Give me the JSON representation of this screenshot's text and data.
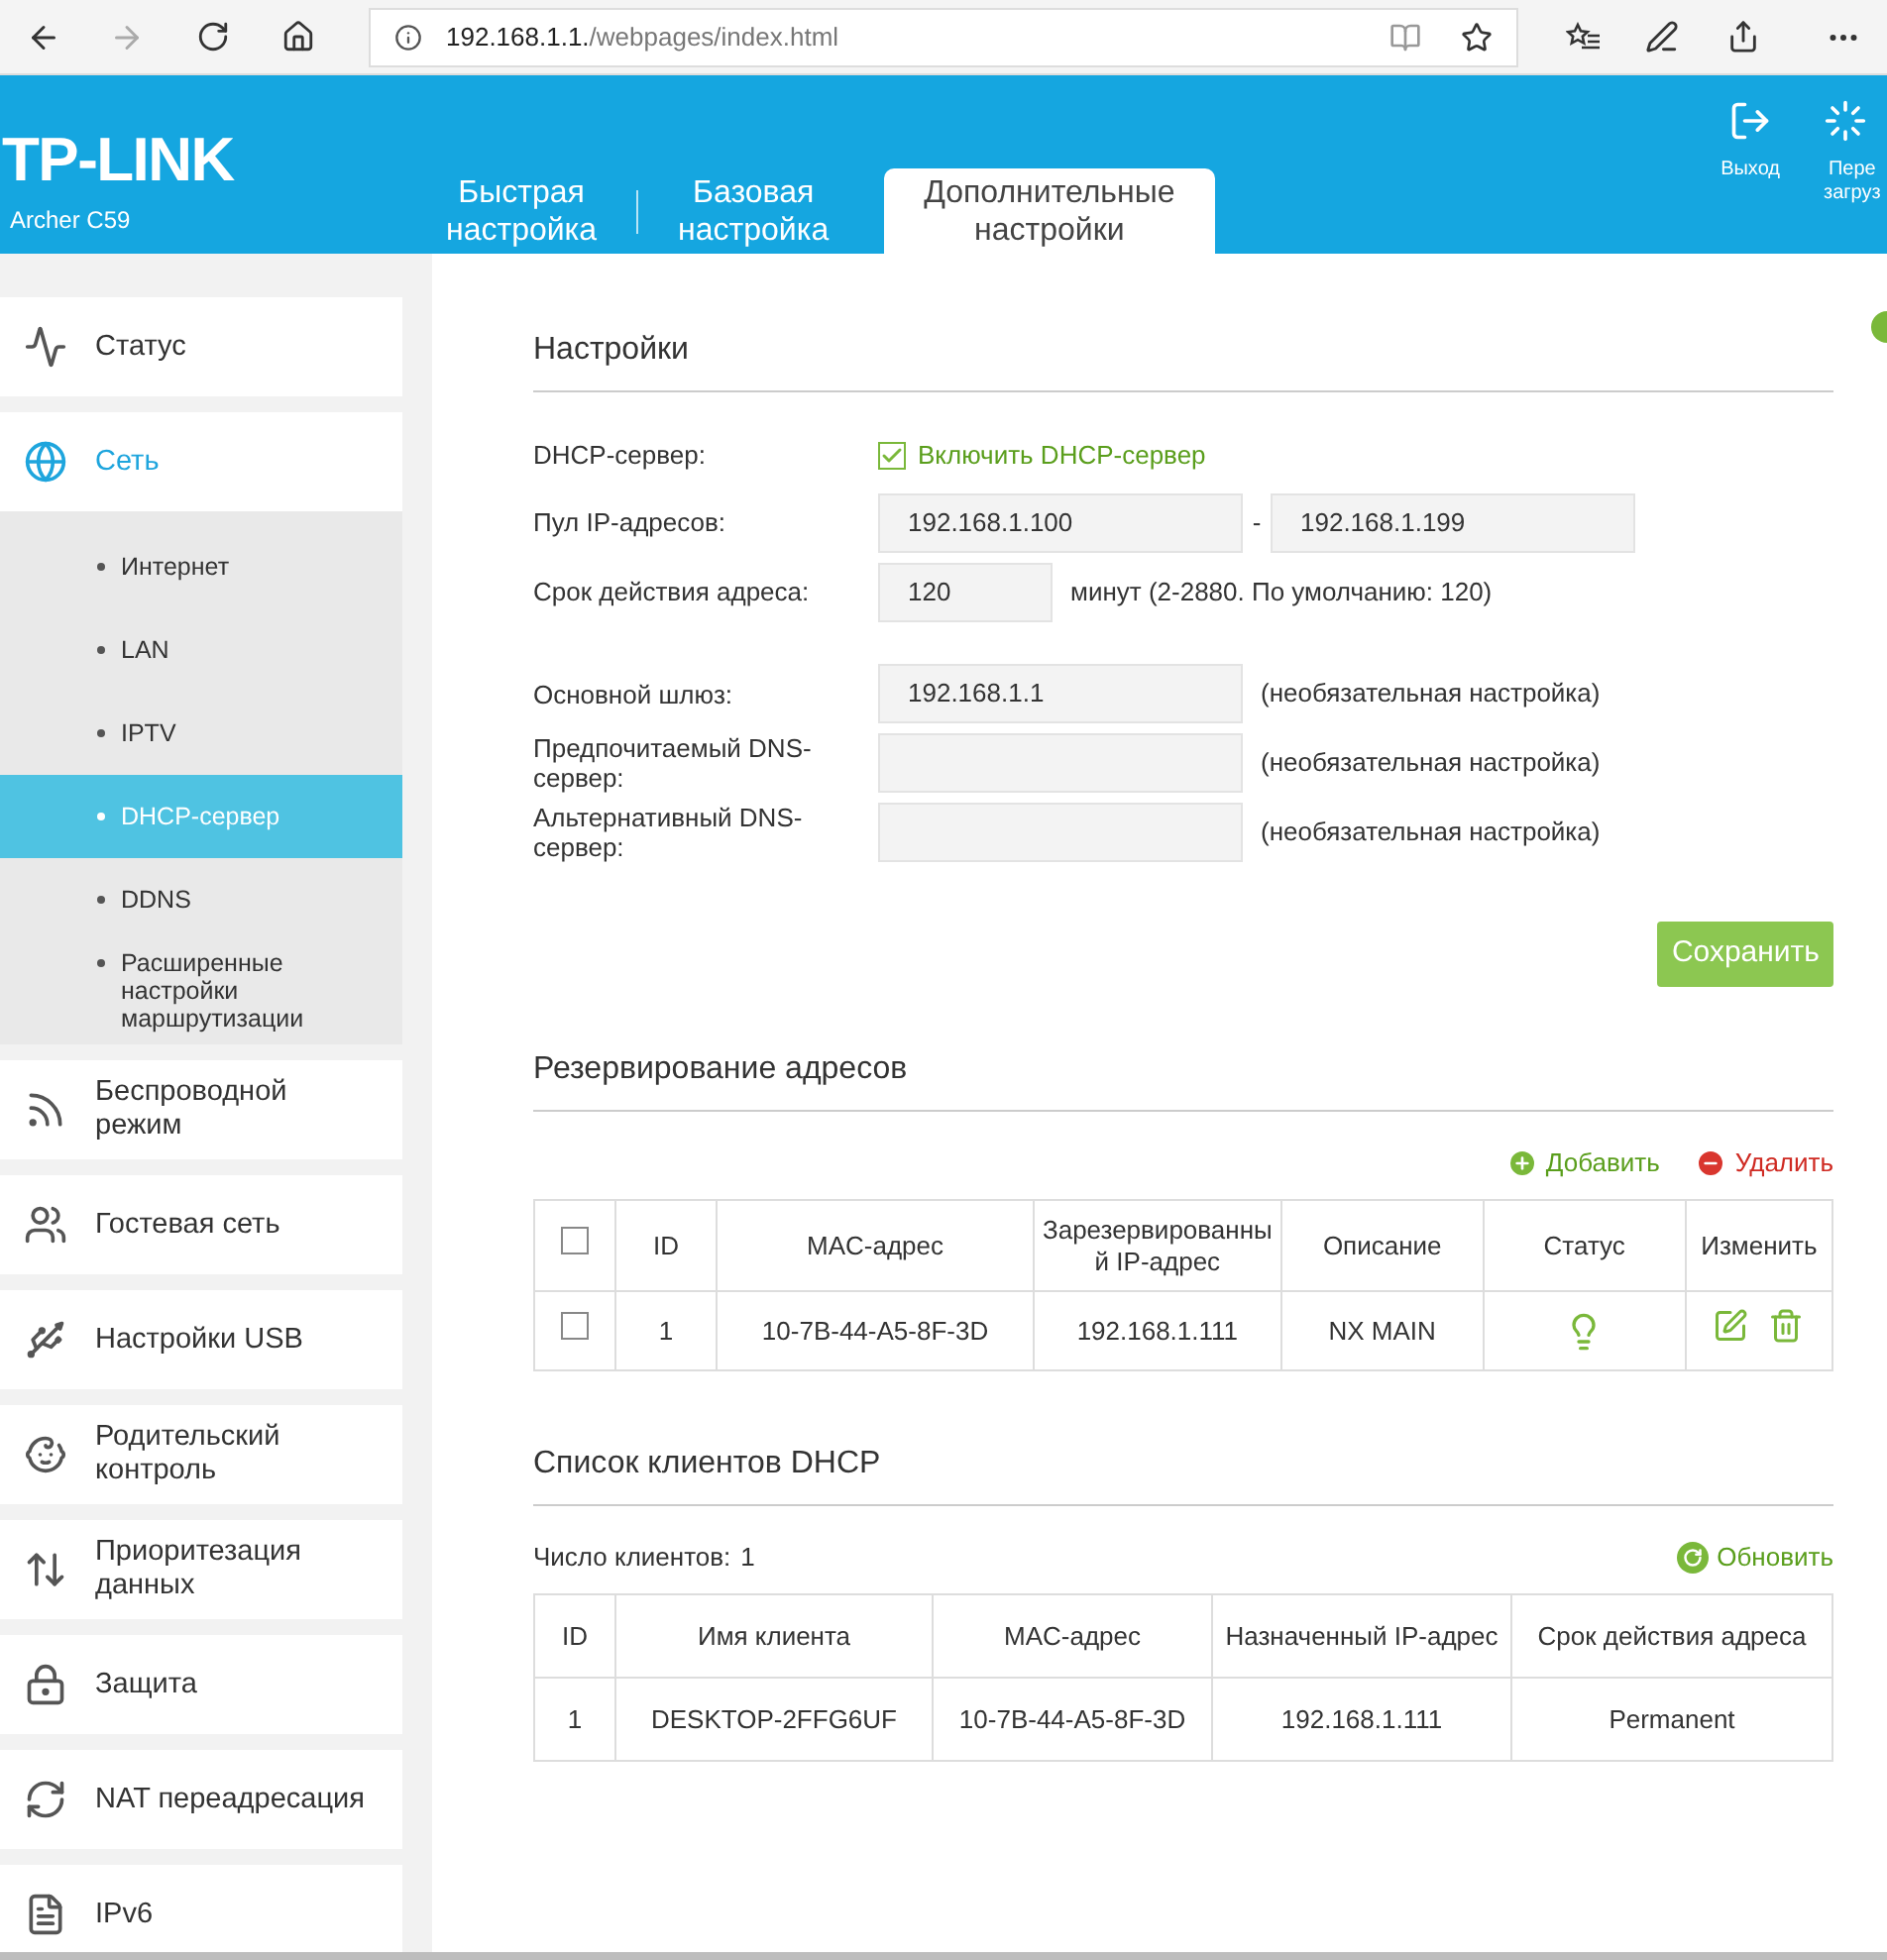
{
  "browser": {
    "url_host": "192.168.1.1.",
    "url_path": "/webpages/index.html",
    "forward_disabled": true
  },
  "header": {
    "logo": "TP-LINK",
    "model": "Archer C59",
    "tabs": [
      {
        "label": "Быстрая\nнастройка",
        "selected": false
      },
      {
        "label": "Базовая\nнастройка",
        "selected": false
      },
      {
        "label": "Дополнительные\nнастройки",
        "selected": true
      }
    ],
    "actions": [
      {
        "label": "Выход"
      },
      {
        "label": "Пере\nзагруз"
      }
    ]
  },
  "sidebar": {
    "items": [
      {
        "label": "Статус",
        "selected": false
      },
      {
        "label": "Сеть",
        "selected": true,
        "expanded": true,
        "children": [
          {
            "label": "Интернет",
            "selected": false
          },
          {
            "label": "LAN",
            "selected": false
          },
          {
            "label": "IPTV",
            "selected": false
          },
          {
            "label": "DHCP-сервер",
            "selected": true
          },
          {
            "label": "DDNS",
            "selected": false
          },
          {
            "label": "Расширенные\nнастройки\nмаршрутизации",
            "selected": false
          }
        ]
      },
      {
        "label": "Беспроводной\nрежим",
        "selected": false
      },
      {
        "label": "Гостевая сеть",
        "selected": false
      },
      {
        "label": "Настройки USB",
        "selected": false
      },
      {
        "label": "Родительский\nконтроль",
        "selected": false
      },
      {
        "label": "Приоритезация\nданных",
        "selected": false
      },
      {
        "label": "Защита",
        "selected": false
      },
      {
        "label": "NAT переадресация",
        "selected": false
      },
      {
        "label": "IPv6",
        "selected": false
      }
    ]
  },
  "settings": {
    "title": "Настройки",
    "dhcp": {
      "label": "DHCP-сервер:",
      "option": "Включить DHCP-сервер",
      "checked": true
    },
    "pool": {
      "label": "Пул IP-адресов:",
      "start": "192.168.1.100",
      "separator": "-",
      "end": "192.168.1.199"
    },
    "lease": {
      "label": "Срок действия адреса:",
      "value": "120",
      "hint": "минут (2-2880. По умолчанию: 120)"
    },
    "fields": [
      {
        "label": "Основной шлюз:",
        "value": "192.168.1.1",
        "hint": "(необязательная настройка)"
      },
      {
        "label": "Предпочитаемый DNS-\nсервер:",
        "hint": "(необязательная настройка)"
      },
      {
        "label": "Альтернативный DNS-\nсервер:",
        "hint": "(необязательная настройка)"
      }
    ],
    "save": "Сохранить"
  },
  "reservation": {
    "title": "Резервирование адресов",
    "add": "Добавить",
    "delete": "Удалить",
    "select_all_checked": false,
    "columns": [
      "ID",
      "MAC-адрес",
      "Зарезервированны\nй IP-адрес",
      "Описание",
      "Статус",
      "Изменить"
    ],
    "rows": [
      {
        "checked": false,
        "id": "1",
        "mac": "10-7B-44-A5-8F-3D",
        "ip": "192.168.1.111",
        "description": "NX MAIN",
        "enabled": true
      }
    ]
  },
  "clients": {
    "title": "Список клиентов DHCP",
    "count_label": "Число клиентов:",
    "count": "1",
    "refresh": "Обновить",
    "columns": [
      "ID",
      "Имя клиента",
      "MAC-адрес",
      "Назначенный IP-адрес",
      "Срок действия адреса"
    ],
    "rows": [
      {
        "id": "1",
        "name": "DESKTOP-2FFG6UF",
        "mac": "10-7B-44-A5-8F-3D",
        "ip": "192.168.1.111",
        "lease": "Permanent"
      }
    ]
  }
}
